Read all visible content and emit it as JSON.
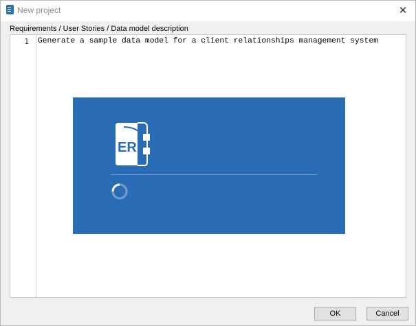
{
  "window": {
    "title": "New project",
    "close_glyph": "✕"
  },
  "form": {
    "label": "Requirements / User Stories / Data model description"
  },
  "editor": {
    "lines": [
      {
        "number": "1",
        "text": "Generate a sample data model for a client relationships management system"
      }
    ]
  },
  "splash": {
    "logo_text": "ER",
    "background_color": "#2a6bb5",
    "icons": [
      "er-logo-icon",
      "loading-spinner-icon"
    ]
  },
  "buttons": {
    "ok_label": "OK",
    "cancel_label": "Cancel"
  },
  "colors": {
    "accent": "#2a6bb5"
  }
}
